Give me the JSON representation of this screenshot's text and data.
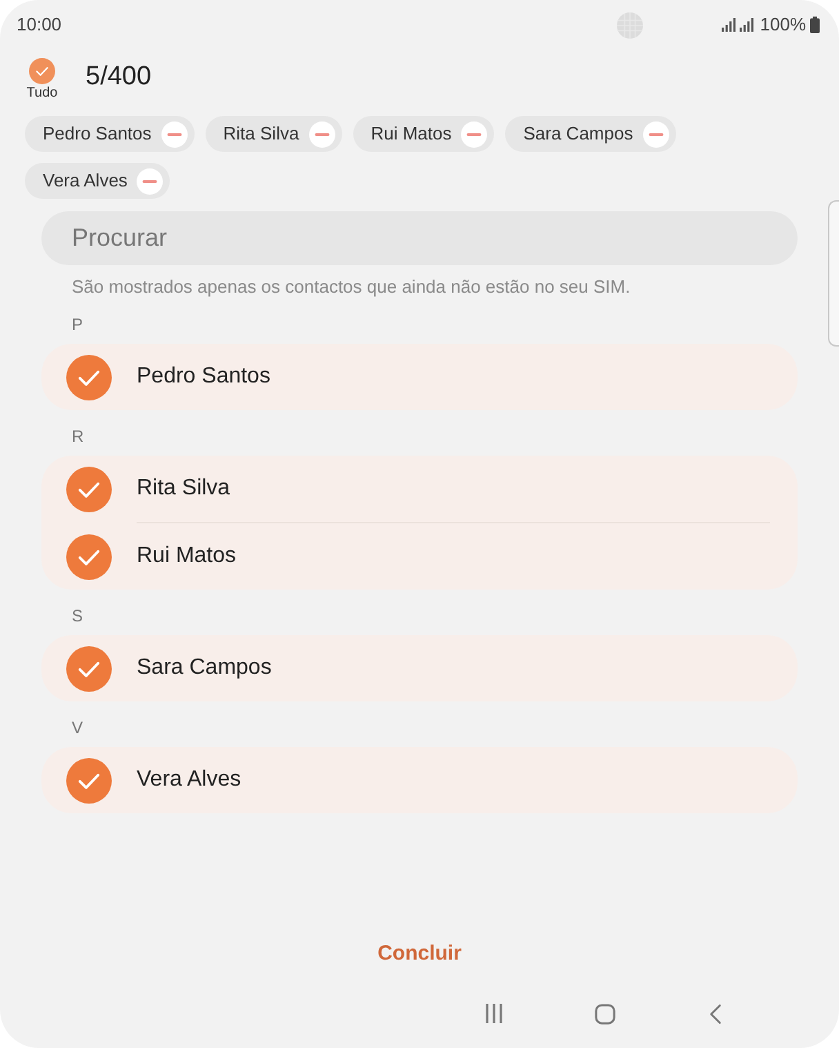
{
  "status_bar": {
    "time": "10:00",
    "battery": "100%"
  },
  "header": {
    "select_all": {
      "label": "Tudo",
      "checked": true
    },
    "count": "5/400"
  },
  "chips": [
    {
      "name": "Pedro Santos"
    },
    {
      "name": "Rita Silva"
    },
    {
      "name": "Rui Matos"
    },
    {
      "name": "Sara Campos"
    },
    {
      "name": "Vera Alves"
    }
  ],
  "search": {
    "placeholder": "Procurar"
  },
  "hint": "São mostrados apenas os contactos que ainda não estão no seu SIM.",
  "sections": [
    {
      "letter": "P",
      "contacts": [
        {
          "name": "Pedro Santos",
          "checked": true
        }
      ]
    },
    {
      "letter": "R",
      "contacts": [
        {
          "name": "Rita Silva",
          "checked": true
        },
        {
          "name": "Rui Matos",
          "checked": true
        }
      ]
    },
    {
      "letter": "S",
      "contacts": [
        {
          "name": "Sara Campos",
          "checked": true
        }
      ]
    },
    {
      "letter": "V",
      "contacts": [
        {
          "name": "Vera Alves",
          "checked": true
        }
      ]
    }
  ],
  "done_button": {
    "label": "Concluir"
  }
}
